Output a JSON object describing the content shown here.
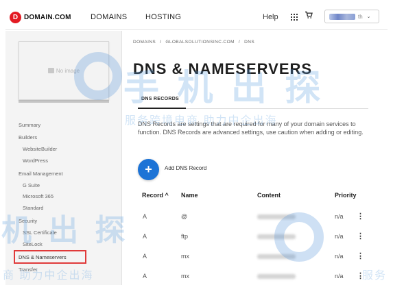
{
  "header": {
    "logo_mark": "D",
    "logo_text": "DOMAIN.COM",
    "nav": [
      "DOMAINS",
      "HOSTING"
    ],
    "help": "Help",
    "account_name": "th",
    "icons": [
      "apps-grid-icon",
      "cart-icon",
      "chevron-down-icon"
    ]
  },
  "sidebar": {
    "thumbnail_label": "No image",
    "items": [
      {
        "label": "Summary",
        "level": "top"
      },
      {
        "label": "Builders",
        "level": "top"
      },
      {
        "label": "WebsiteBuilder",
        "level": "sub"
      },
      {
        "label": "WordPress",
        "level": "sub"
      },
      {
        "label": "Email Management",
        "level": "top"
      },
      {
        "label": "G Suite",
        "level": "sub"
      },
      {
        "label": "Microsoft 365",
        "level": "sub"
      },
      {
        "label": "Standard",
        "level": "sub"
      },
      {
        "label": "Security",
        "level": "top"
      },
      {
        "label": "SSL Certificate",
        "level": "sub"
      },
      {
        "label": "SiteLock",
        "level": "sub"
      },
      {
        "label": "DNS & Nameservers",
        "level": "top"
      },
      {
        "label": "Transfer",
        "level": "top"
      }
    ],
    "highlight_color": "#e03a3a"
  },
  "main": {
    "breadcrumb": [
      "DOMAINS",
      "/",
      "GLOBALSOLUTIONSINC.COM",
      "/",
      "DNS"
    ],
    "title": "DNS & NAMESERVERS",
    "tab": "DNS RECORDS",
    "description": "DNS Records are settings that are required for many of your domain services to function. DNS Records are advanced settings, use caution when adding or editing.",
    "add_button_symbol": "+",
    "add_label": "Add DNS Record",
    "table": {
      "headers": [
        "Record ^",
        "Name",
        "Content",
        "Priority"
      ],
      "rows": [
        {
          "record": "A",
          "name": "@",
          "priority": "n/a"
        },
        {
          "record": "A",
          "name": "ftp",
          "priority": "n/a"
        },
        {
          "record": "A",
          "name": "mx",
          "priority": "n/a"
        },
        {
          "record": "A",
          "name": "mx",
          "priority": "n/a"
        }
      ],
      "row_menu_symbol": "⋮"
    }
  },
  "watermark": {
    "line1": "服务跨境电商 助力中企出海",
    "line2": "商 助力中企出海",
    "brand": "手 机 出 探",
    "brand2": "机 出 探",
    "line3": "服务"
  },
  "colors": {
    "accent": "#1c73d6",
    "brand_red": "#e31b23"
  }
}
